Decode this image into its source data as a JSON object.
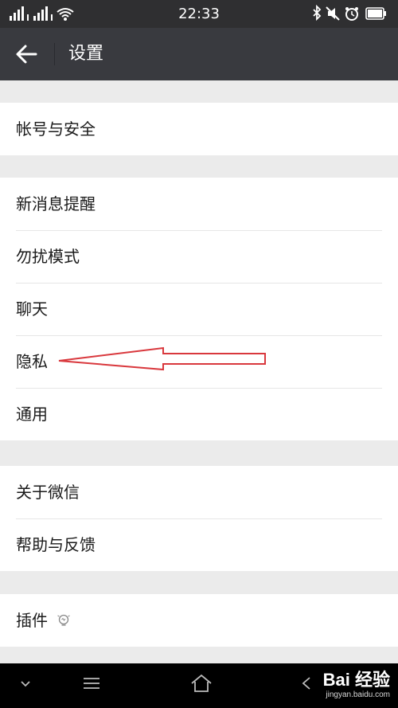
{
  "status_bar": {
    "time": "22:33",
    "left_icons": [
      "signal-icon",
      "signal-icon",
      "wifi-icon"
    ],
    "right_icons": [
      "bluetooth-icon",
      "mute-icon",
      "alarm-icon",
      "battery-icon"
    ]
  },
  "header": {
    "title": "设置",
    "back_icon": "arrow-left-icon"
  },
  "groups": [
    {
      "items": [
        {
          "label": "帐号与安全"
        }
      ]
    },
    {
      "items": [
        {
          "label": "新消息提醒"
        },
        {
          "label": "勿扰模式"
        },
        {
          "label": "聊天"
        },
        {
          "label": "隐私"
        },
        {
          "label": "通用"
        }
      ]
    },
    {
      "items": [
        {
          "label": "关于微信"
        },
        {
          "label": "帮助与反馈"
        }
      ]
    },
    {
      "items": [
        {
          "label": "插件",
          "icon": "lightbulb-icon"
        }
      ]
    }
  ],
  "annotation": {
    "type": "arrow",
    "color": "#d9383d",
    "points_to": "隐私"
  },
  "nav_bar": {
    "buttons": [
      "chevron-down-icon",
      "menu-icon",
      "home-icon",
      "back-icon"
    ]
  },
  "watermark": {
    "brand": "Bai 经验",
    "url": "jingyan.baidu.com"
  },
  "colors": {
    "header_bg": "#393a3f",
    "status_bg": "#2f2f31",
    "page_bg": "#ebebeb",
    "cell_bg": "#ffffff"
  }
}
